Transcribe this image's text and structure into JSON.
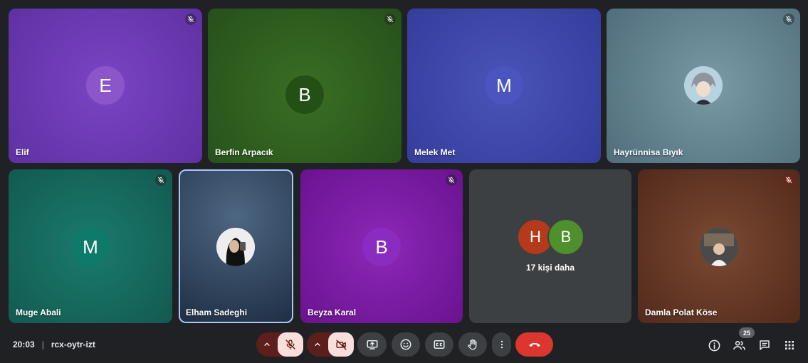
{
  "participants": [
    {
      "name": "Elif",
      "initial": "E",
      "bg": "#6b3bb0",
      "avatar_color": "#8b56c9",
      "muted": true
    },
    {
      "name": "Berfin Arpacık",
      "initial": "B",
      "bg": "#2e5a1d",
      "avatar_color": "#245015",
      "muted": true
    },
    {
      "name": "Melek Met",
      "initial": "M",
      "bg": "#3a42a6",
      "avatar_color": "#4a55bf",
      "muted": false
    },
    {
      "name": "Hayrünnisa Bıyık",
      "initial": "",
      "bg": "#5b7a86",
      "avatar_color": "#9fb7c4",
      "muted": true
    },
    {
      "name": "Muge Abali",
      "initial": "M",
      "bg": "#17675d",
      "avatar_color": "#0e7a6a",
      "muted": true
    },
    {
      "name": "Elham Sadeghi",
      "initial": "",
      "bg": "#2b3e57",
      "avatar_color": "#1a1a1a",
      "muted": false
    },
    {
      "name": "Beyza Karal",
      "initial": "B",
      "bg": "#7a1aa6",
      "avatar_color": "#8a2cc0",
      "muted": true
    },
    {
      "name": "Damla Polat Köse",
      "initial": "",
      "bg": "#6b3d2a",
      "avatar_color": "#3d3d3d",
      "muted": true
    }
  ],
  "more": {
    "initials": [
      "H",
      "B"
    ],
    "colors": [
      "#b5391b",
      "#4f8f2c"
    ],
    "label": "17 kişi daha"
  },
  "meeting": {
    "time": "20:03",
    "separator": "|",
    "code": "rcx-oytr-izt"
  },
  "controls": {
    "participant_count": "25"
  },
  "icons": [
    "mic-off-icon",
    "videocam-off-icon",
    "present-icon",
    "emoji-icon",
    "captions-icon",
    "raise-hand-icon",
    "more-vert-icon",
    "call-end-icon",
    "info-icon",
    "people-icon",
    "chat-icon",
    "apps-icon"
  ]
}
